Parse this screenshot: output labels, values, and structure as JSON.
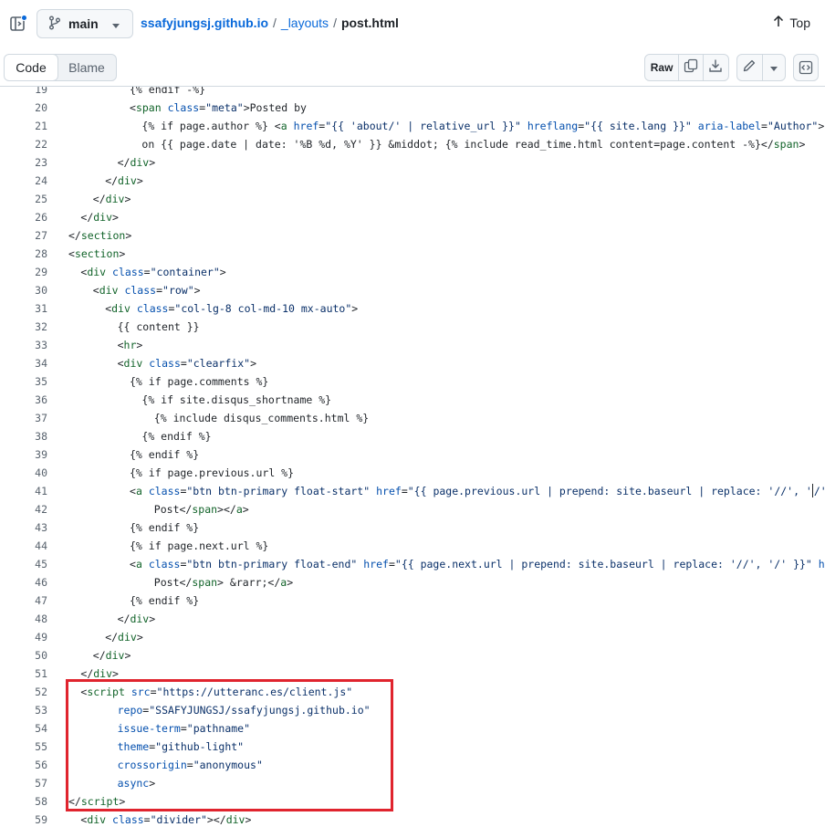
{
  "branch": {
    "name": "main"
  },
  "breadcrumb": {
    "repo": "ssafyjungsj.github.io",
    "sep1": "/",
    "folder": "_layouts",
    "sep2": "/",
    "file": "post.html"
  },
  "top": {
    "label": "Top"
  },
  "tabs": {
    "code": "Code",
    "blame": "Blame"
  },
  "toolbar": {
    "raw": "Raw"
  },
  "icons": {
    "sidebar": "sidebar-toggle-icon",
    "branch": "git-branch-icon",
    "caret": "triangle-down-icon",
    "top": "arrow-up-icon",
    "copy": "copy-icon",
    "download": "download-icon",
    "edit": "pencil-icon",
    "more": "triangle-down-icon",
    "symbols": "code-square-icon"
  },
  "colors": {
    "link": "#0969da",
    "tag": "#116329",
    "attr": "#0550ae",
    "string": "#0a3069",
    "highlight_box": "#e0242e"
  },
  "code_lines": [
    {
      "n": "19",
      "indent": 6,
      "parts": [
        [
          "t",
          "{% endif -%}"
        ]
      ]
    },
    {
      "n": "20",
      "indent": 6,
      "parts": [
        [
          "p",
          "<"
        ],
        [
          "g",
          "span"
        ],
        [
          "p",
          " "
        ],
        [
          "a",
          "class"
        ],
        [
          "p",
          "="
        ],
        [
          "s",
          "\"meta\""
        ],
        [
          "p",
          ">Posted by"
        ]
      ]
    },
    {
      "n": "21",
      "indent": 7,
      "parts": [
        [
          "t",
          "{% if page.author %} <"
        ],
        [
          "g",
          "a"
        ],
        [
          "p",
          " "
        ],
        [
          "a",
          "href"
        ],
        [
          "p",
          "="
        ],
        [
          "s",
          "\"{{ 'about/' | relative_url }}\""
        ],
        [
          "p",
          " "
        ],
        [
          "a",
          "hreflang"
        ],
        [
          "p",
          "="
        ],
        [
          "s",
          "\"{{ site.lang }}\""
        ],
        [
          "p",
          " "
        ],
        [
          "a",
          "aria-label"
        ],
        [
          "p",
          "="
        ],
        [
          "s",
          "\"Author\""
        ],
        [
          "p",
          ">{{ p"
        ]
      ]
    },
    {
      "n": "22",
      "indent": 7,
      "parts": [
        [
          "t",
          "on {{ page.date | date: '%B %d, %Y' }} &middot; {% include read_time.html content=page.content -%}</"
        ],
        [
          "g",
          "span"
        ],
        [
          "p",
          ">"
        ]
      ]
    },
    {
      "n": "23",
      "indent": 5,
      "parts": [
        [
          "p",
          "</"
        ],
        [
          "g",
          "div"
        ],
        [
          "p",
          ">"
        ]
      ]
    },
    {
      "n": "24",
      "indent": 4,
      "parts": [
        [
          "p",
          "</"
        ],
        [
          "g",
          "div"
        ],
        [
          "p",
          ">"
        ]
      ]
    },
    {
      "n": "25",
      "indent": 3,
      "parts": [
        [
          "p",
          "</"
        ],
        [
          "g",
          "div"
        ],
        [
          "p",
          ">"
        ]
      ]
    },
    {
      "n": "26",
      "indent": 2,
      "parts": [
        [
          "p",
          "</"
        ],
        [
          "g",
          "div"
        ],
        [
          "p",
          ">"
        ]
      ]
    },
    {
      "n": "27",
      "indent": 1,
      "parts": [
        [
          "p",
          "</"
        ],
        [
          "g",
          "section"
        ],
        [
          "p",
          ">"
        ]
      ]
    },
    {
      "n": "28",
      "indent": 1,
      "parts": [
        [
          "p",
          "<"
        ],
        [
          "g",
          "section"
        ],
        [
          "p",
          ">"
        ]
      ]
    },
    {
      "n": "29",
      "indent": 2,
      "parts": [
        [
          "p",
          "<"
        ],
        [
          "g",
          "div"
        ],
        [
          "p",
          " "
        ],
        [
          "a",
          "class"
        ],
        [
          "p",
          "="
        ],
        [
          "s",
          "\"container\""
        ],
        [
          "p",
          ">"
        ]
      ]
    },
    {
      "n": "30",
      "indent": 3,
      "parts": [
        [
          "p",
          "<"
        ],
        [
          "g",
          "div"
        ],
        [
          "p",
          " "
        ],
        [
          "a",
          "class"
        ],
        [
          "p",
          "="
        ],
        [
          "s",
          "\"row\""
        ],
        [
          "p",
          ">"
        ]
      ]
    },
    {
      "n": "31",
      "indent": 4,
      "parts": [
        [
          "p",
          "<"
        ],
        [
          "g",
          "div"
        ],
        [
          "p",
          " "
        ],
        [
          "a",
          "class"
        ],
        [
          "p",
          "="
        ],
        [
          "s",
          "\"col-lg-8 col-md-10 mx-auto\""
        ],
        [
          "p",
          ">"
        ]
      ]
    },
    {
      "n": "32",
      "indent": 5,
      "parts": [
        [
          "t",
          "{{ content }}"
        ]
      ]
    },
    {
      "n": "33",
      "indent": 5,
      "parts": [
        [
          "p",
          "<"
        ],
        [
          "g",
          "hr"
        ],
        [
          "p",
          ">"
        ]
      ]
    },
    {
      "n": "34",
      "indent": 5,
      "parts": [
        [
          "p",
          "<"
        ],
        [
          "g",
          "div"
        ],
        [
          "p",
          " "
        ],
        [
          "a",
          "class"
        ],
        [
          "p",
          "="
        ],
        [
          "s",
          "\"clearfix\""
        ],
        [
          "p",
          ">"
        ]
      ]
    },
    {
      "n": "35",
      "indent": 6,
      "parts": [
        [
          "t",
          "{% if page.comments %}"
        ]
      ]
    },
    {
      "n": "36",
      "indent": 7,
      "parts": [
        [
          "t",
          "{% if site.disqus_shortname %}"
        ]
      ]
    },
    {
      "n": "37",
      "indent": 8,
      "parts": [
        [
          "t",
          "{% include disqus_comments.html %}"
        ]
      ]
    },
    {
      "n": "38",
      "indent": 7,
      "parts": [
        [
          "t",
          "{% endif %}"
        ]
      ]
    },
    {
      "n": "39",
      "indent": 6,
      "parts": [
        [
          "t",
          "{% endif %}"
        ]
      ]
    },
    {
      "n": "40",
      "indent": 6,
      "parts": [
        [
          "t",
          "{% if page.previous.url %}"
        ]
      ]
    },
    {
      "n": "41",
      "indent": 6,
      "parts": [
        [
          "p",
          "<"
        ],
        [
          "g",
          "a"
        ],
        [
          "p",
          " "
        ],
        [
          "a",
          "class"
        ],
        [
          "p",
          "="
        ],
        [
          "s",
          "\"btn btn-primary float-start\""
        ],
        [
          "p",
          " "
        ],
        [
          "a",
          "href"
        ],
        [
          "p",
          "="
        ],
        [
          "s",
          "\"{{ page.previous.url | prepend: site.baseurl | replace: '//', '"
        ],
        [
          "c",
          ""
        ],
        [
          "s",
          "/' }}\""
        ]
      ]
    },
    {
      "n": "42",
      "indent": 8,
      "parts": [
        [
          "p",
          "Post</"
        ],
        [
          "g",
          "span"
        ],
        [
          "p",
          "></"
        ],
        [
          "g",
          "a"
        ],
        [
          "p",
          ">"
        ]
      ]
    },
    {
      "n": "43",
      "indent": 6,
      "parts": [
        [
          "t",
          "{% endif %}"
        ]
      ]
    },
    {
      "n": "44",
      "indent": 6,
      "parts": [
        [
          "t",
          "{% if page.next.url %}"
        ]
      ]
    },
    {
      "n": "45",
      "indent": 6,
      "parts": [
        [
          "p",
          "<"
        ],
        [
          "g",
          "a"
        ],
        [
          "p",
          " "
        ],
        [
          "a",
          "class"
        ],
        [
          "p",
          "="
        ],
        [
          "s",
          "\"btn btn-primary float-end\""
        ],
        [
          "p",
          " "
        ],
        [
          "a",
          "href"
        ],
        [
          "p",
          "="
        ],
        [
          "s",
          "\"{{ page.next.url | prepend: site.baseurl | replace: '//', '/' }}\""
        ],
        [
          "p",
          " "
        ],
        [
          "a",
          "hrefl"
        ]
      ]
    },
    {
      "n": "46",
      "indent": 8,
      "parts": [
        [
          "p",
          "Post</"
        ],
        [
          "g",
          "span"
        ],
        [
          "p",
          "> &rarr;</"
        ],
        [
          "g",
          "a"
        ],
        [
          "p",
          ">"
        ]
      ]
    },
    {
      "n": "47",
      "indent": 6,
      "parts": [
        [
          "t",
          "{% endif %}"
        ]
      ]
    },
    {
      "n": "48",
      "indent": 5,
      "parts": [
        [
          "p",
          "</"
        ],
        [
          "g",
          "div"
        ],
        [
          "p",
          ">"
        ]
      ]
    },
    {
      "n": "49",
      "indent": 4,
      "parts": [
        [
          "p",
          "</"
        ],
        [
          "g",
          "div"
        ],
        [
          "p",
          ">"
        ]
      ]
    },
    {
      "n": "50",
      "indent": 3,
      "parts": [
        [
          "p",
          "</"
        ],
        [
          "g",
          "div"
        ],
        [
          "p",
          ">"
        ]
      ]
    },
    {
      "n": "51",
      "indent": 2,
      "parts": [
        [
          "p",
          "</"
        ],
        [
          "g",
          "div"
        ],
        [
          "p",
          ">"
        ]
      ]
    },
    {
      "n": "52",
      "indent": 2,
      "parts": [
        [
          "p",
          "<"
        ],
        [
          "g",
          "script"
        ],
        [
          "p",
          " "
        ],
        [
          "a",
          "src"
        ],
        [
          "p",
          "="
        ],
        [
          "s",
          "\"https://utteranc.es/client.js\""
        ]
      ]
    },
    {
      "n": "53",
      "indent": 5,
      "parts": [
        [
          "a",
          "repo"
        ],
        [
          "p",
          "="
        ],
        [
          "s",
          "\"SSAFYJUNGSJ/ssafyjungsj.github.io\""
        ]
      ]
    },
    {
      "n": "54",
      "indent": 5,
      "parts": [
        [
          "a",
          "issue-term"
        ],
        [
          "p",
          "="
        ],
        [
          "s",
          "\"pathname\""
        ]
      ]
    },
    {
      "n": "55",
      "indent": 5,
      "parts": [
        [
          "a",
          "theme"
        ],
        [
          "p",
          "="
        ],
        [
          "s",
          "\"github-light\""
        ]
      ]
    },
    {
      "n": "56",
      "indent": 5,
      "parts": [
        [
          "a",
          "crossorigin"
        ],
        [
          "p",
          "="
        ],
        [
          "s",
          "\"anonymous\""
        ]
      ]
    },
    {
      "n": "57",
      "indent": 5,
      "parts": [
        [
          "a",
          "async"
        ],
        [
          "p",
          ">"
        ]
      ]
    },
    {
      "n": "58",
      "indent": 1,
      "parts": [
        [
          "p",
          "</"
        ],
        [
          "g",
          "script"
        ],
        [
          "p",
          ">"
        ]
      ]
    },
    {
      "n": "59",
      "indent": 2,
      "parts": [
        [
          "p",
          "<"
        ],
        [
          "g",
          "div"
        ],
        [
          "p",
          " "
        ],
        [
          "a",
          "class"
        ],
        [
          "p",
          "="
        ],
        [
          "s",
          "\"divider\""
        ],
        [
          "p",
          "></"
        ],
        [
          "g",
          "div"
        ],
        [
          "p",
          ">"
        ]
      ]
    }
  ]
}
